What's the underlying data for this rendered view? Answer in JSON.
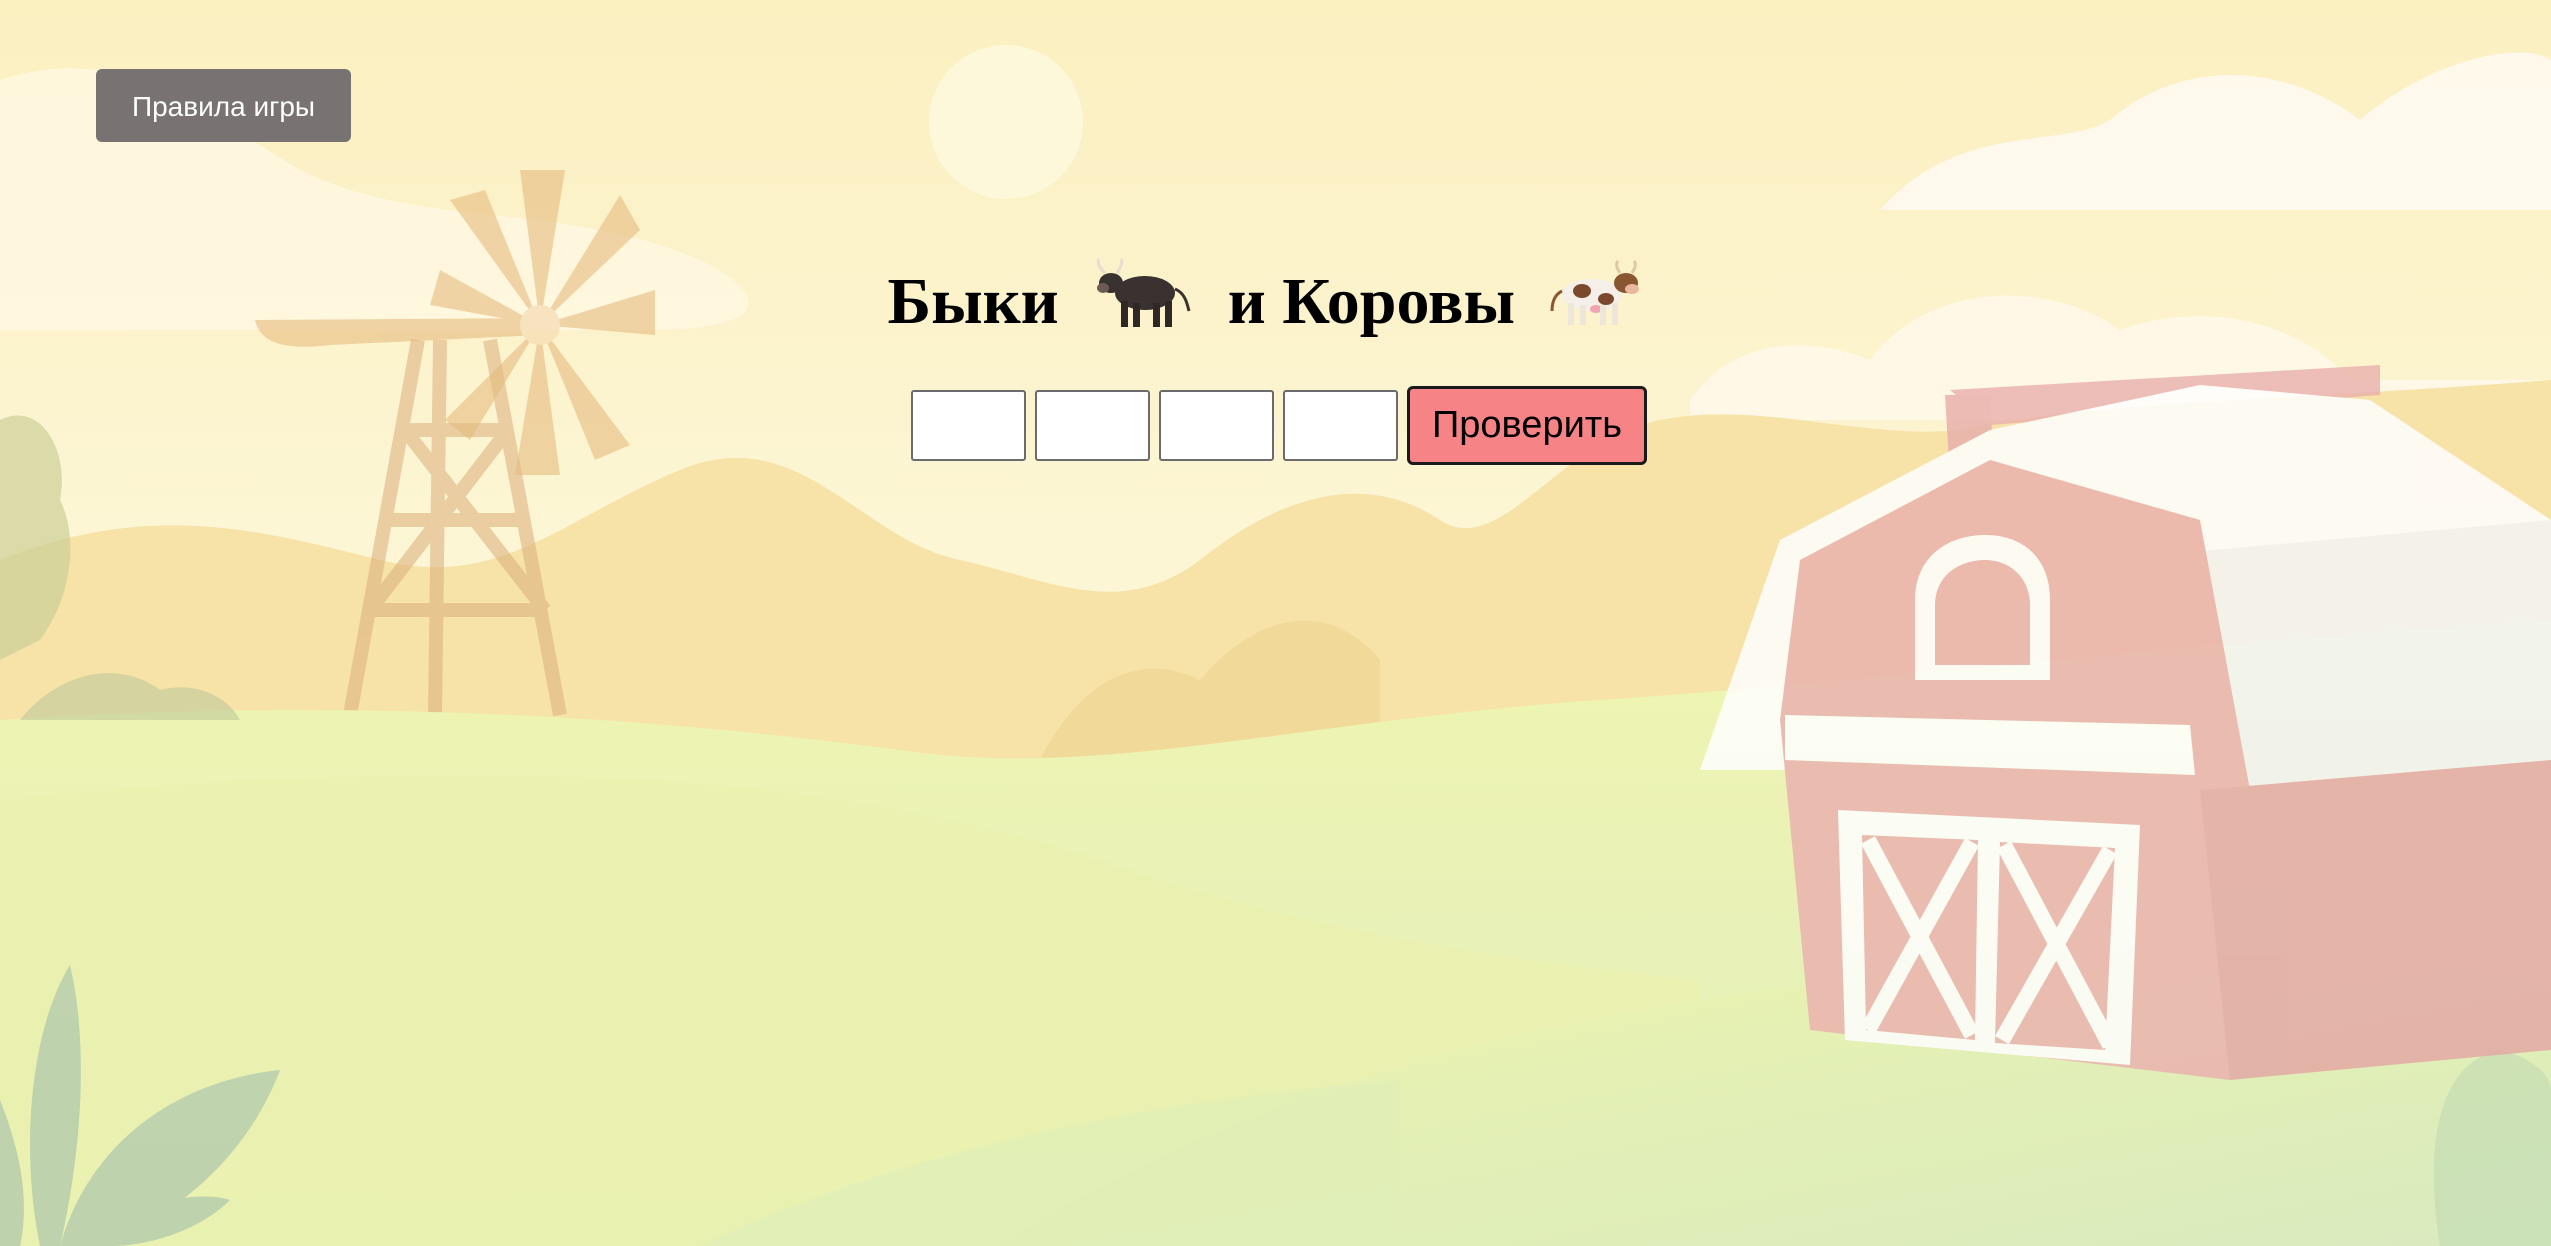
{
  "rules_button": {
    "label": "Правила игры"
  },
  "title": {
    "word1": "Быки",
    "word2": "и Коровы",
    "icon1": "bull-icon",
    "icon2": "cow-icon"
  },
  "guess": {
    "digits": [
      "",
      "",
      "",
      ""
    ],
    "check_label": "Проверить"
  },
  "colors": {
    "rules_button_bg": "#787372",
    "check_button_bg": "#f68486",
    "sky": "#fbf0c4",
    "field": "#e9f2a8",
    "barn": "#e8a9a4"
  }
}
